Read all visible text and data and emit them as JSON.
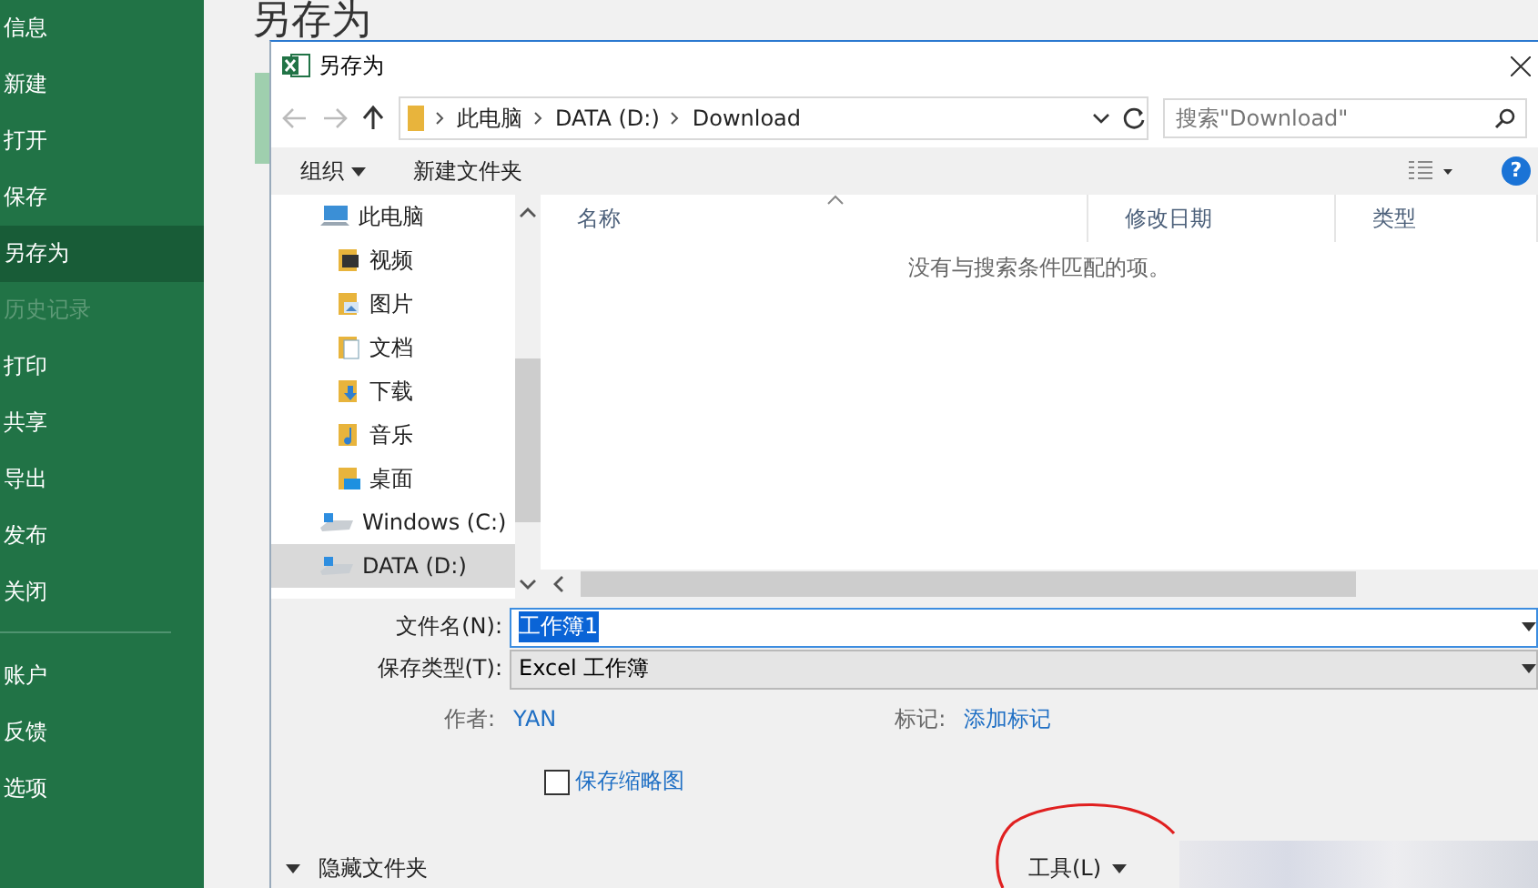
{
  "sidebar": {
    "items": [
      {
        "label": "信息",
        "selected": false,
        "disabled": false
      },
      {
        "label": "新建",
        "selected": false,
        "disabled": false
      },
      {
        "label": "打开",
        "selected": false,
        "disabled": false
      },
      {
        "label": "保存",
        "selected": false,
        "disabled": false
      },
      {
        "label": "另存为",
        "selected": true,
        "disabled": false
      },
      {
        "label": "历史记录",
        "selected": false,
        "disabled": true
      },
      {
        "label": "打印",
        "selected": false,
        "disabled": false
      },
      {
        "label": "共享",
        "selected": false,
        "disabled": false
      },
      {
        "label": "导出",
        "selected": false,
        "disabled": false
      },
      {
        "label": "发布",
        "selected": false,
        "disabled": false
      },
      {
        "label": "关闭",
        "selected": false,
        "disabled": false
      }
    ],
    "bottom_items": [
      {
        "label": "账户",
        "selected": false,
        "disabled": false
      },
      {
        "label": "反馈",
        "selected": false,
        "disabled": false
      },
      {
        "label": "选项",
        "selected": false,
        "disabled": false
      }
    ]
  },
  "page_title": "另存为",
  "dialog": {
    "title": "另存为",
    "address": {
      "path": [
        "此电脑",
        "DATA (D:)",
        "Download"
      ]
    },
    "search": {
      "placeholder": "搜索\"Download\""
    },
    "toolbar": {
      "organize": "组织",
      "new_folder": "新建文件夹",
      "help": "?"
    },
    "nav_tree": [
      {
        "label": "此电脑",
        "kind": "pc",
        "selected": false
      },
      {
        "label": "视频",
        "kind": "video",
        "selected": false
      },
      {
        "label": "图片",
        "kind": "pictures",
        "selected": false
      },
      {
        "label": "文档",
        "kind": "documents",
        "selected": false
      },
      {
        "label": "下载",
        "kind": "downloads",
        "selected": false
      },
      {
        "label": "音乐",
        "kind": "music",
        "selected": false
      },
      {
        "label": "桌面",
        "kind": "desktop",
        "selected": false
      },
      {
        "label": "Windows (C:)",
        "kind": "drive",
        "selected": false
      },
      {
        "label": "DATA (D:)",
        "kind": "drive",
        "selected": true
      }
    ],
    "file_list": {
      "columns": [
        "名称",
        "修改日期",
        "类型"
      ],
      "empty_message": "没有与搜索条件匹配的项。"
    },
    "file_name": {
      "label": "文件名(N):",
      "value": "工作簿1",
      "selected": true
    },
    "save_type": {
      "label": "保存类型(T):",
      "value": "Excel 工作簿"
    },
    "author": {
      "label": "作者:",
      "value": "YAN"
    },
    "tags": {
      "label": "标记:",
      "value": "添加标记"
    },
    "thumbnail": {
      "label": "保存缩略图",
      "checked": false
    },
    "hide_folders": "隐藏文件夹",
    "tools": "工具(L)"
  }
}
